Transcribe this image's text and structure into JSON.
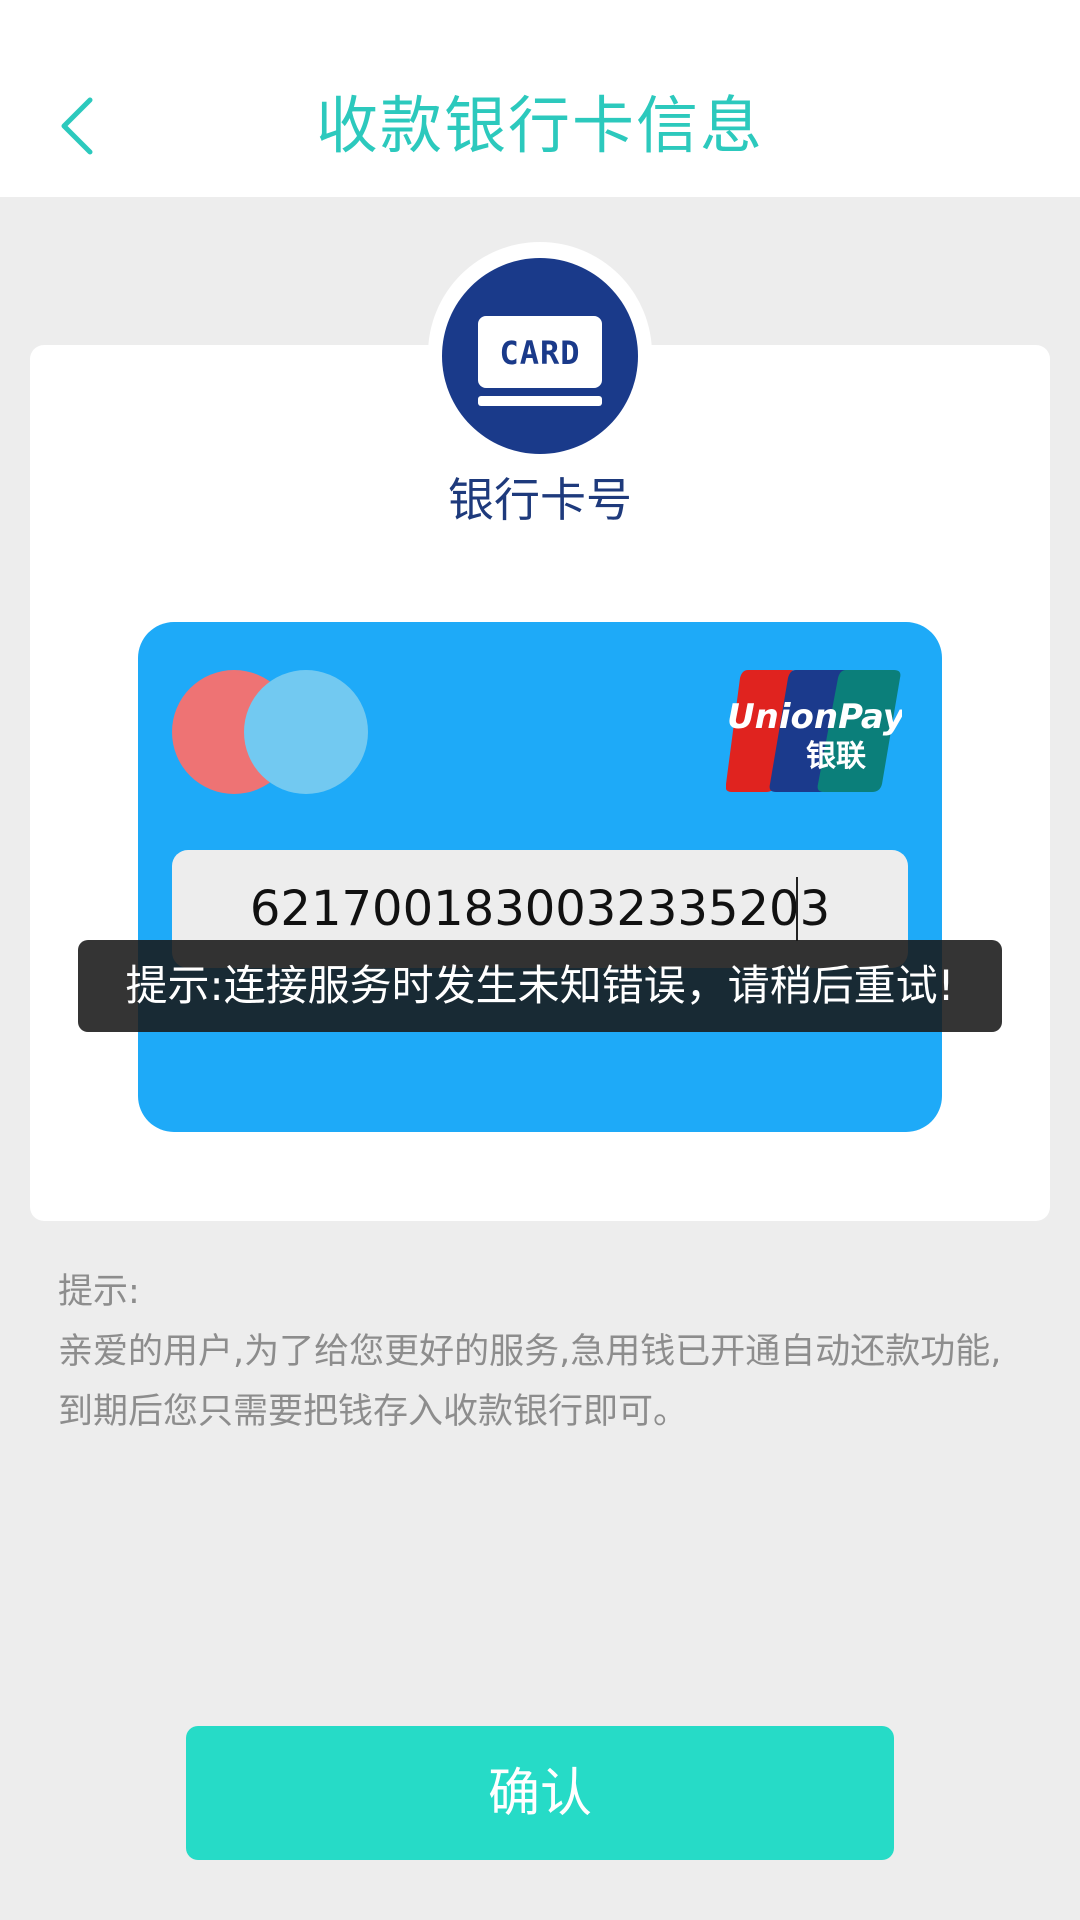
{
  "header": {
    "title": "收款银行卡信息",
    "back_icon": "chevron-left-icon"
  },
  "badge": {
    "icon_text": "CARD",
    "label": "银行卡号"
  },
  "bank_card": {
    "brand_logo": {
      "line1": "UnionPay",
      "line2": "银联"
    },
    "card_number": "6217001830032335203"
  },
  "toast": {
    "message": "提示:连接服务时发生未知错误，请稍后重试!"
  },
  "notes": {
    "heading": "提示:",
    "line1": "亲爱的用户,为了给您更好的服务,急用钱已开通自动还款功能,",
    "line2": "到期后您只需要把钱存入收款银行即可。"
  },
  "confirm_button": {
    "label": "确认"
  },
  "colors": {
    "accent": "#2cc9bd",
    "button": "#26dbc7",
    "card_blue": "#1eaaf8",
    "badge_navy": "#1a3a8a"
  }
}
